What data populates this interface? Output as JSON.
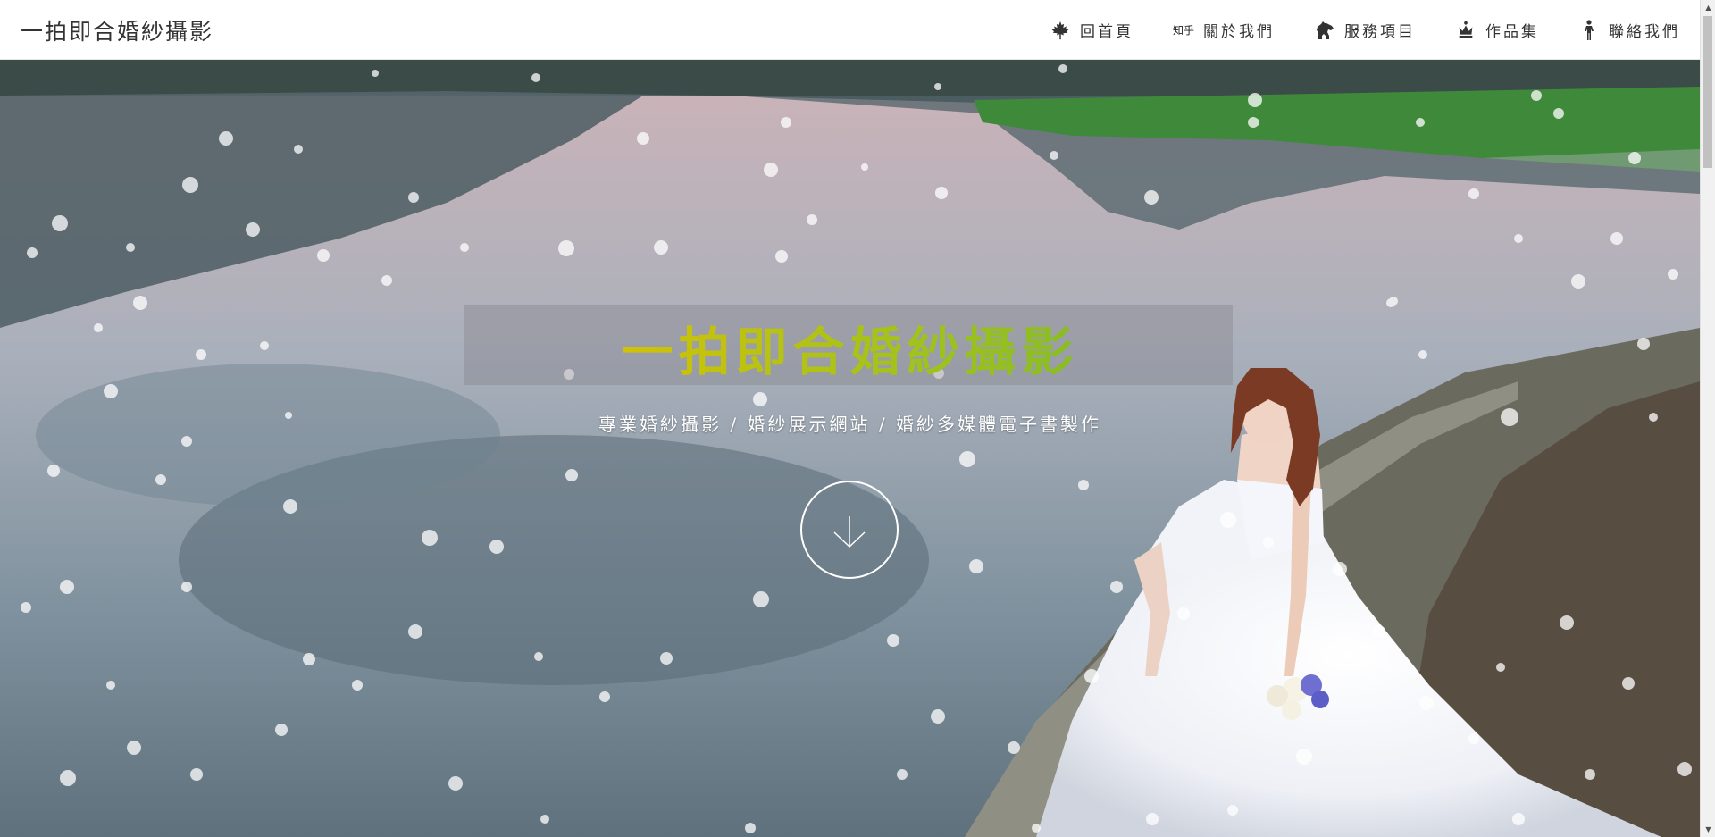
{
  "navbar": {
    "brand": "一拍即合婚紗攝影",
    "items": [
      {
        "label": "回首頁",
        "icon": "maple-leaf-icon"
      },
      {
        "label": "關於我們",
        "icon": "zhihu-icon",
        "icon_text": "知乎"
      },
      {
        "label": "服務項目",
        "icon": "horse-icon"
      },
      {
        "label": "作品集",
        "icon": "chess-queen-icon"
      },
      {
        "label": "聯絡我們",
        "icon": "person-icon"
      }
    ]
  },
  "hero": {
    "title": "一拍即合婚紗攝影",
    "subtitle": "專業婚紗攝影 / 婚紗展示網站 / 婚紗多媒體電子書製作",
    "scroll_icon": "arrow-down-icon",
    "title_gradient": [
      "#f5c400",
      "#9ec21d",
      "#4c8b2b"
    ]
  },
  "colors": {
    "nav_text": "#333333",
    "hero_text": "#ffffff"
  }
}
